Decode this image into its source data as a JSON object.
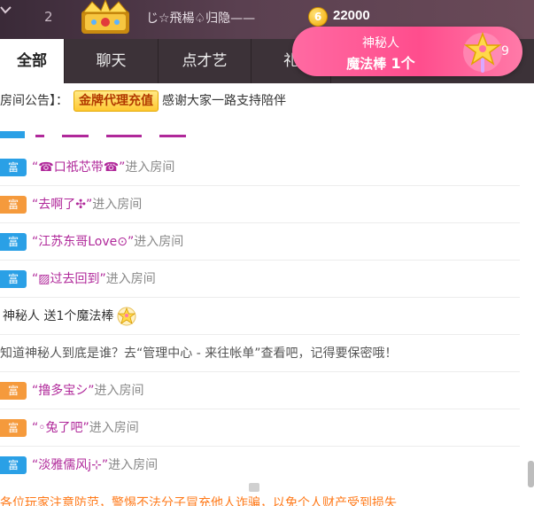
{
  "rank": {
    "number": "2",
    "name": "じ☆飛楊♤归隐——",
    "coin_glyph": "6",
    "score": "22000"
  },
  "tabs": [
    {
      "label": "全部",
      "active": true
    },
    {
      "label": "聊天",
      "active": false
    },
    {
      "label": "点才艺",
      "active": false
    },
    {
      "label": "礼",
      "active": false
    }
  ],
  "gift_popup": {
    "sender": "神秘人",
    "gift": "魔法棒",
    "count": "1个",
    "extra": "9"
  },
  "announcement": {
    "prefix": "房间公告】：",
    "badge": "金牌代理充值",
    "text": "感谢大家一路支持陪伴"
  },
  "messages": [
    {
      "type": "enter",
      "tag": "富",
      "tag_color": "blue",
      "user": "“☎口祇芯带☎”",
      "suffix": "进入房间"
    },
    {
      "type": "enter",
      "tag": "富",
      "tag_color": "orange",
      "user": "“去啊了✣”",
      "suffix": "进入房间"
    },
    {
      "type": "enter",
      "tag": "富",
      "tag_color": "blue",
      "user": "“江苏东哥Love⊙”",
      "suffix": "进入房间"
    },
    {
      "type": "enter",
      "tag": "富",
      "tag_color": "blue",
      "user": "“▨过去回到”",
      "suffix": "进入房间"
    },
    {
      "type": "gift",
      "text": "神秘人 送1个魔法棒"
    },
    {
      "type": "notice",
      "text": "知道神秘人到底是谁？去“管理中心 - 来往帐单”查看吧，记得要保密哦！"
    },
    {
      "type": "enter",
      "tag": "富",
      "tag_color": "orange",
      "user": "“撸多宝シ”",
      "suffix": "进入房间"
    },
    {
      "type": "enter",
      "tag": "富",
      "tag_color": "orange",
      "user": "“◦兔了吧”",
      "suffix": "进入房间"
    },
    {
      "type": "enter",
      "tag": "富",
      "tag_color": "blue",
      "user": "“淡雅儒风j⊹”",
      "suffix": "进入房间"
    }
  ],
  "warning": "各位玩家注意防范，警惕不法分子冒充他人诈骗，以免个人财产受到损失"
}
